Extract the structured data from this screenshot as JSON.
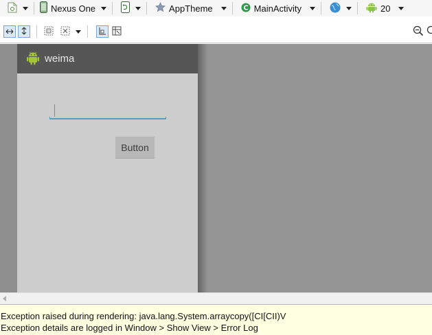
{
  "toolbar": {
    "device_label": "Nexus One",
    "theme_label": "AppTheme",
    "activity_label": "MainActivity",
    "api_level": "20"
  },
  "device_preview": {
    "app_title": "weima",
    "edit_text_value": "",
    "button_label": "Button"
  },
  "error_log": {
    "line1": "Exception raised during rendering: java.lang.System.arraycopy([CI[CII)V",
    "line2": "Exception details are logged in Window > Show View > Error Log"
  },
  "colors": {
    "action_bar": "#565656",
    "device_background": "#cdcdcd",
    "canvas_background": "#949494",
    "edittext_accent": "#4f9fbd",
    "error_background": "#ffffe1",
    "android_green": "#a4c639"
  }
}
